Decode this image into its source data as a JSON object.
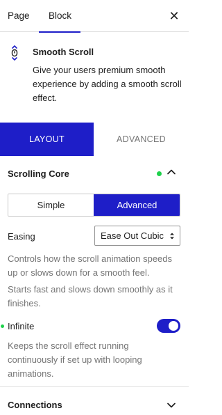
{
  "top_tabs": {
    "page": "Page",
    "block": "Block",
    "close": "✕"
  },
  "block_card": {
    "title": "Smooth Scroll",
    "description": "Give your users premium smooth experience by adding a smooth scroll effect.",
    "icon": "smooth-scroll-icon"
  },
  "panel_tabs": {
    "layout": "LAYOUT",
    "advanced": "ADVANCED",
    "selected": "LAYOUT"
  },
  "section": {
    "title": "Scrolling Core",
    "expanded": true,
    "mode_options": [
      "Simple",
      "Advanced"
    ],
    "mode_selected": "Advanced",
    "easing_label": "Easing",
    "easing_value": "Ease Out Cubic",
    "easing_help_1": "Controls how the scroll animation speeds up or slows down for a smooth feel.",
    "easing_help_2": "Starts fast and slows down smoothly as it finishes.",
    "infinite_label": "Infinite",
    "infinite_enabled": true,
    "infinite_help": "Keeps the scroll effect running continuously if set up with looping animations."
  },
  "connections": {
    "title": "Connections",
    "expanded": false
  },
  "colors": {
    "accent": "#1e1ec8",
    "status_green": "#1ed14b",
    "muted_text": "#757575",
    "border": "#e0e0e0"
  }
}
